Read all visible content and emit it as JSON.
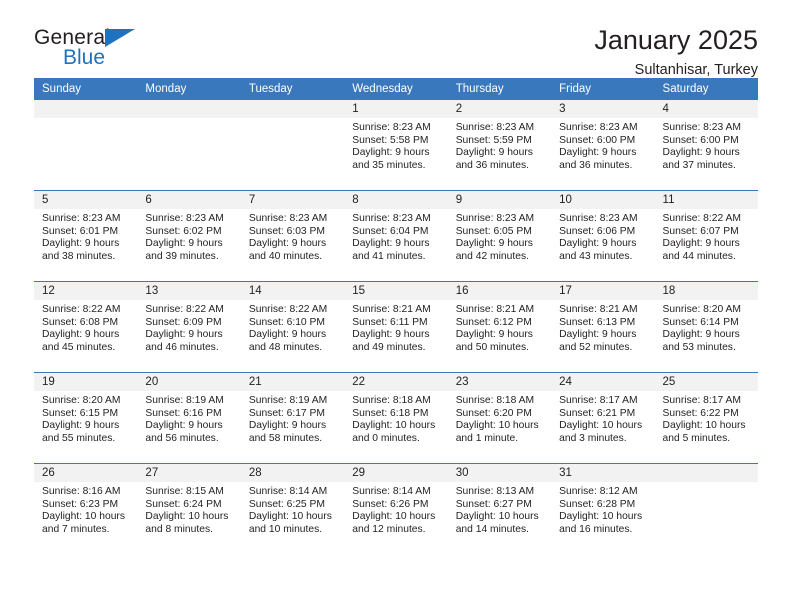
{
  "brand": {
    "word_one": "General",
    "word_two": "Blue",
    "accent_color": "#1f72bf"
  },
  "header": {
    "title": "January 2025",
    "subtitle": "Sultanhisar, Turkey"
  },
  "calendar": {
    "header_bg": "#3a78bd",
    "daynum_bg": "#f2f2f2",
    "weekday_headers": [
      "Sunday",
      "Monday",
      "Tuesday",
      "Wednesday",
      "Thursday",
      "Friday",
      "Saturday"
    ],
    "weeks": [
      [
        {
          "day": "",
          "lines": []
        },
        {
          "day": "",
          "lines": []
        },
        {
          "day": "",
          "lines": []
        },
        {
          "day": "1",
          "lines": [
            "Sunrise: 8:23 AM",
            "Sunset: 5:58 PM",
            "Daylight: 9 hours",
            "and 35 minutes."
          ]
        },
        {
          "day": "2",
          "lines": [
            "Sunrise: 8:23 AM",
            "Sunset: 5:59 PM",
            "Daylight: 9 hours",
            "and 36 minutes."
          ]
        },
        {
          "day": "3",
          "lines": [
            "Sunrise: 8:23 AM",
            "Sunset: 6:00 PM",
            "Daylight: 9 hours",
            "and 36 minutes."
          ]
        },
        {
          "day": "4",
          "lines": [
            "Sunrise: 8:23 AM",
            "Sunset: 6:00 PM",
            "Daylight: 9 hours",
            "and 37 minutes."
          ]
        }
      ],
      [
        {
          "day": "5",
          "lines": [
            "Sunrise: 8:23 AM",
            "Sunset: 6:01 PM",
            "Daylight: 9 hours",
            "and 38 minutes."
          ]
        },
        {
          "day": "6",
          "lines": [
            "Sunrise: 8:23 AM",
            "Sunset: 6:02 PM",
            "Daylight: 9 hours",
            "and 39 minutes."
          ]
        },
        {
          "day": "7",
          "lines": [
            "Sunrise: 8:23 AM",
            "Sunset: 6:03 PM",
            "Daylight: 9 hours",
            "and 40 minutes."
          ]
        },
        {
          "day": "8",
          "lines": [
            "Sunrise: 8:23 AM",
            "Sunset: 6:04 PM",
            "Daylight: 9 hours",
            "and 41 minutes."
          ]
        },
        {
          "day": "9",
          "lines": [
            "Sunrise: 8:23 AM",
            "Sunset: 6:05 PM",
            "Daylight: 9 hours",
            "and 42 minutes."
          ]
        },
        {
          "day": "10",
          "lines": [
            "Sunrise: 8:23 AM",
            "Sunset: 6:06 PM",
            "Daylight: 9 hours",
            "and 43 minutes."
          ]
        },
        {
          "day": "11",
          "lines": [
            "Sunrise: 8:22 AM",
            "Sunset: 6:07 PM",
            "Daylight: 9 hours",
            "and 44 minutes."
          ]
        }
      ],
      [
        {
          "day": "12",
          "lines": [
            "Sunrise: 8:22 AM",
            "Sunset: 6:08 PM",
            "Daylight: 9 hours",
            "and 45 minutes."
          ]
        },
        {
          "day": "13",
          "lines": [
            "Sunrise: 8:22 AM",
            "Sunset: 6:09 PM",
            "Daylight: 9 hours",
            "and 46 minutes."
          ]
        },
        {
          "day": "14",
          "lines": [
            "Sunrise: 8:22 AM",
            "Sunset: 6:10 PM",
            "Daylight: 9 hours",
            "and 48 minutes."
          ]
        },
        {
          "day": "15",
          "lines": [
            "Sunrise: 8:21 AM",
            "Sunset: 6:11 PM",
            "Daylight: 9 hours",
            "and 49 minutes."
          ]
        },
        {
          "day": "16",
          "lines": [
            "Sunrise: 8:21 AM",
            "Sunset: 6:12 PM",
            "Daylight: 9 hours",
            "and 50 minutes."
          ]
        },
        {
          "day": "17",
          "lines": [
            "Sunrise: 8:21 AM",
            "Sunset: 6:13 PM",
            "Daylight: 9 hours",
            "and 52 minutes."
          ]
        },
        {
          "day": "18",
          "lines": [
            "Sunrise: 8:20 AM",
            "Sunset: 6:14 PM",
            "Daylight: 9 hours",
            "and 53 minutes."
          ]
        }
      ],
      [
        {
          "day": "19",
          "lines": [
            "Sunrise: 8:20 AM",
            "Sunset: 6:15 PM",
            "Daylight: 9 hours",
            "and 55 minutes."
          ]
        },
        {
          "day": "20",
          "lines": [
            "Sunrise: 8:19 AM",
            "Sunset: 6:16 PM",
            "Daylight: 9 hours",
            "and 56 minutes."
          ]
        },
        {
          "day": "21",
          "lines": [
            "Sunrise: 8:19 AM",
            "Sunset: 6:17 PM",
            "Daylight: 9 hours",
            "and 58 minutes."
          ]
        },
        {
          "day": "22",
          "lines": [
            "Sunrise: 8:18 AM",
            "Sunset: 6:18 PM",
            "Daylight: 10 hours",
            "and 0 minutes."
          ]
        },
        {
          "day": "23",
          "lines": [
            "Sunrise: 8:18 AM",
            "Sunset: 6:20 PM",
            "Daylight: 10 hours",
            "and 1 minute."
          ]
        },
        {
          "day": "24",
          "lines": [
            "Sunrise: 8:17 AM",
            "Sunset: 6:21 PM",
            "Daylight: 10 hours",
            "and 3 minutes."
          ]
        },
        {
          "day": "25",
          "lines": [
            "Sunrise: 8:17 AM",
            "Sunset: 6:22 PM",
            "Daylight: 10 hours",
            "and 5 minutes."
          ]
        }
      ],
      [
        {
          "day": "26",
          "lines": [
            "Sunrise: 8:16 AM",
            "Sunset: 6:23 PM",
            "Daylight: 10 hours",
            "and 7 minutes."
          ]
        },
        {
          "day": "27",
          "lines": [
            "Sunrise: 8:15 AM",
            "Sunset: 6:24 PM",
            "Daylight: 10 hours",
            "and 8 minutes."
          ]
        },
        {
          "day": "28",
          "lines": [
            "Sunrise: 8:14 AM",
            "Sunset: 6:25 PM",
            "Daylight: 10 hours",
            "and 10 minutes."
          ]
        },
        {
          "day": "29",
          "lines": [
            "Sunrise: 8:14 AM",
            "Sunset: 6:26 PM",
            "Daylight: 10 hours",
            "and 12 minutes."
          ]
        },
        {
          "day": "30",
          "lines": [
            "Sunrise: 8:13 AM",
            "Sunset: 6:27 PM",
            "Daylight: 10 hours",
            "and 14 minutes."
          ]
        },
        {
          "day": "31",
          "lines": [
            "Sunrise: 8:12 AM",
            "Sunset: 6:28 PM",
            "Daylight: 10 hours",
            "and 16 minutes."
          ]
        },
        {
          "day": "",
          "lines": []
        }
      ]
    ]
  }
}
